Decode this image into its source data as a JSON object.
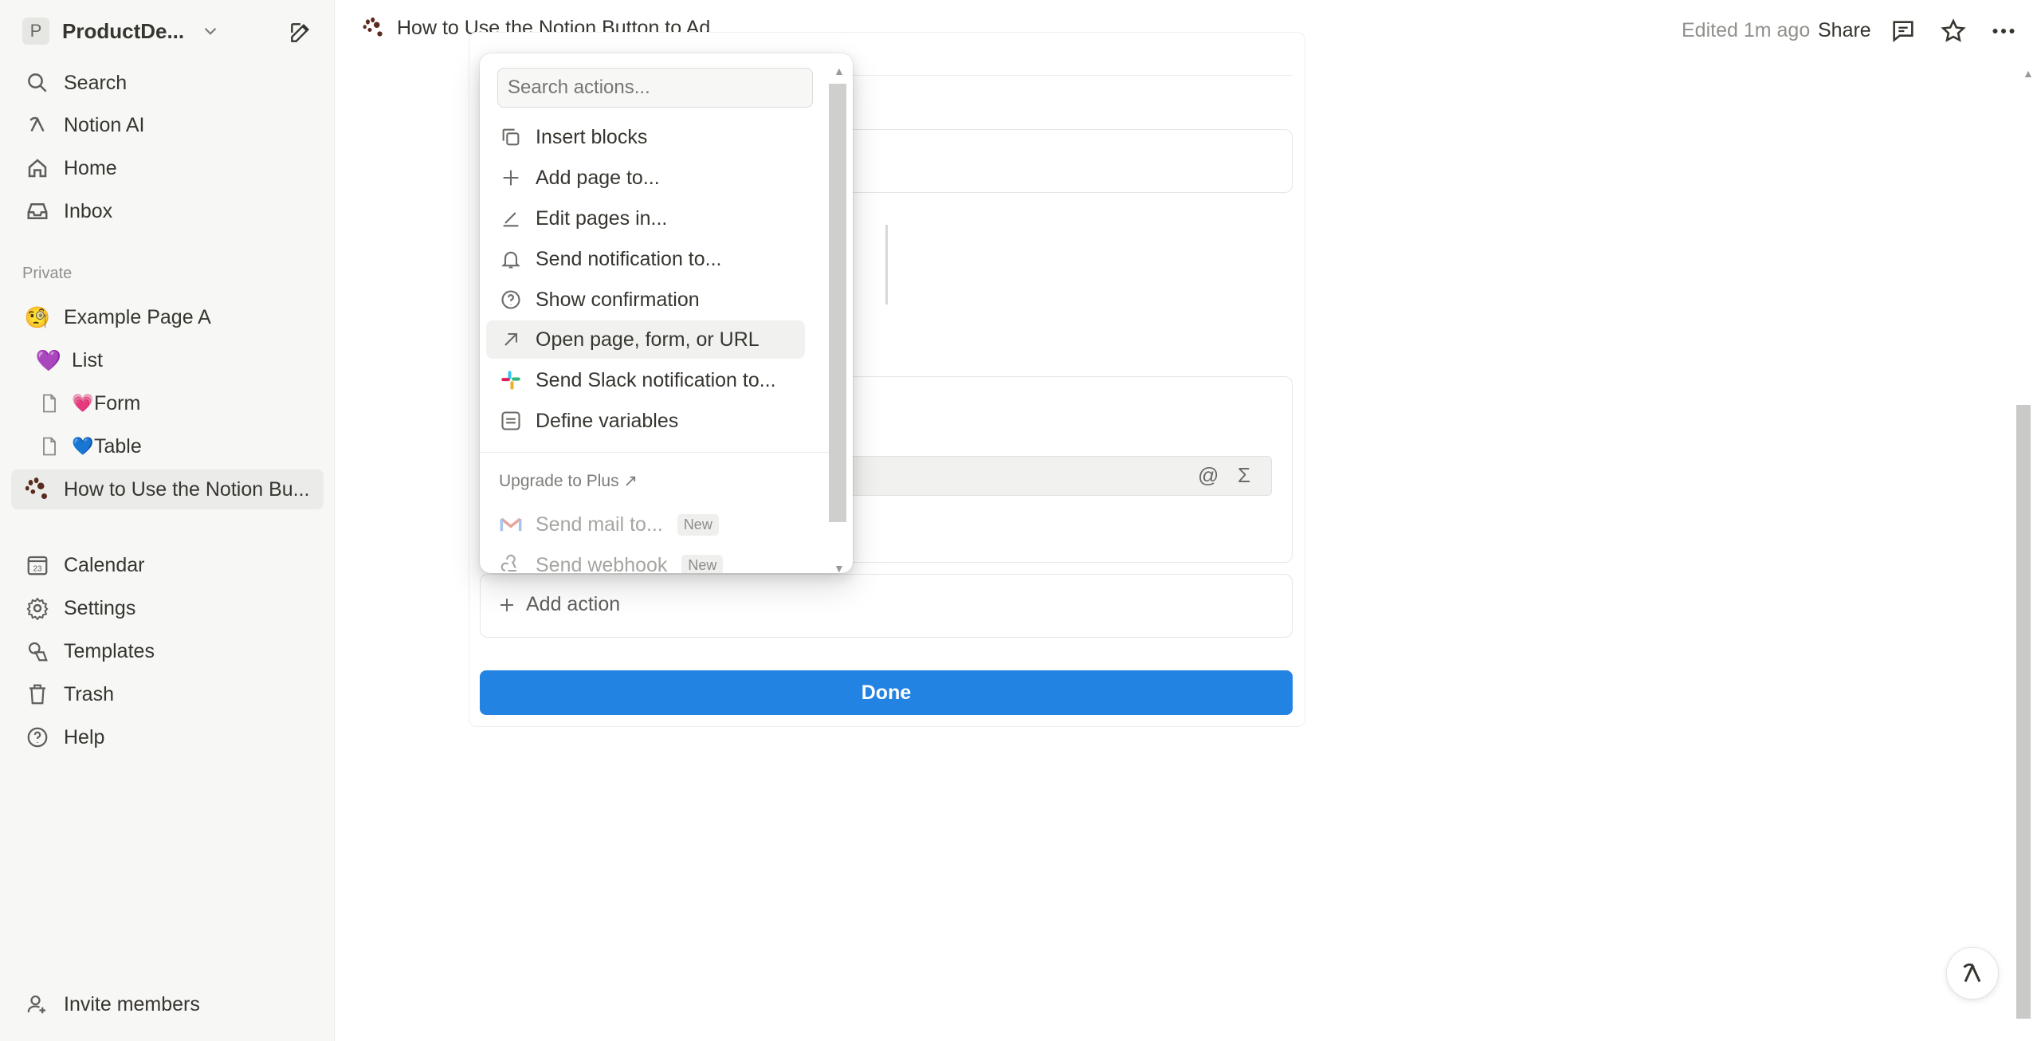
{
  "workspace": {
    "initial": "P",
    "name": "ProductDe..."
  },
  "sidebar": {
    "nav": [
      {
        "label": "Search",
        "icon": "search-icon"
      },
      {
        "label": "Notion AI",
        "icon": "notion-ai-icon"
      },
      {
        "label": "Home",
        "icon": "home-icon"
      },
      {
        "label": "Inbox",
        "icon": "inbox-icon"
      }
    ],
    "section_label": "Private",
    "pages": [
      {
        "label": "Example Page A",
        "emoji": "🧐"
      },
      {
        "label": "List",
        "emoji": "💜"
      },
      {
        "label": "Form",
        "emoji": "💗"
      },
      {
        "label": "Table",
        "emoji": "💙"
      },
      {
        "label": "How to Use the Notion Bu...",
        "emoji": "paw"
      }
    ],
    "bottom_nav": [
      {
        "label": "Calendar",
        "icon": "calendar-icon",
        "badge": "23"
      },
      {
        "label": "Settings",
        "icon": "gear-icon"
      },
      {
        "label": "Templates",
        "icon": "templates-icon"
      },
      {
        "label": "Trash",
        "icon": "trash-icon"
      },
      {
        "label": "Help",
        "icon": "help-icon"
      }
    ],
    "invite": "Invite members"
  },
  "topbar": {
    "breadcrumb": "How to Use the Notion Button to Ad...",
    "edited": "Edited 1m ago",
    "share": "Share"
  },
  "menu": {
    "search_placeholder": "Search actions...",
    "items": [
      {
        "label": "Insert blocks",
        "icon": "copy-icon"
      },
      {
        "label": "Add page to...",
        "icon": "plus-icon"
      },
      {
        "label": "Edit pages in...",
        "icon": "edit-icon"
      },
      {
        "label": "Send notification to...",
        "icon": "bell-icon"
      },
      {
        "label": "Show confirmation",
        "icon": "question-icon"
      },
      {
        "label": "Open page, form, or URL",
        "icon": "arrow-up-right-icon"
      },
      {
        "label": "Send Slack notification to...",
        "icon": "slack-icon"
      },
      {
        "label": "Define variables",
        "icon": "variables-icon"
      }
    ],
    "upgrade": "Upgrade to Plus ↗",
    "premium": [
      {
        "label": "Send mail to...",
        "badge": "New",
        "icon": "gmail-icon"
      },
      {
        "label": "Send webhook",
        "badge": "New",
        "icon": "webhook-icon"
      }
    ]
  },
  "editor": {
    "add_action": "Add action",
    "done": "Done",
    "formula_symbols": {
      "at": "@",
      "sigma": "Σ"
    }
  },
  "colors": {
    "accent": "#2383e2",
    "sidebar_bg": "#f7f7f5"
  }
}
